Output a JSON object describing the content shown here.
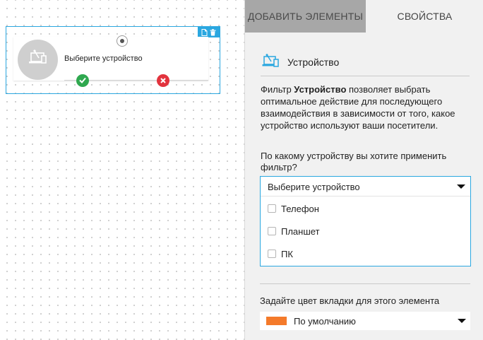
{
  "canvas": {
    "node": {
      "label": "Выберите устройство",
      "avatar_icon": "device-icon",
      "tool_icons": [
        "copy-icon",
        "trash-icon"
      ],
      "ports": {
        "yes_color": "#2fa84f",
        "no_color": "#e2333d"
      }
    }
  },
  "tabs": [
    {
      "label": "ДОБАВИТЬ ЭЛЕМЕНТЫ",
      "active": false
    },
    {
      "label": "СВОЙСТВА",
      "active": true
    }
  ],
  "properties": {
    "section_title": "Устройство",
    "section_icon": "device-icon",
    "description": {
      "before": "Фильтр ",
      "bold": "Устройство",
      "after": " позволяет выбрать оптимальное действие для последующего взаимодействия в зависимости от того, какое устройство используют ваши посетители."
    },
    "question": "По какому устройству вы хотите применить фильтр?",
    "device_select": {
      "value": "Выберите устройство",
      "options": [
        "Телефон",
        "Планшет",
        "ПК"
      ]
    },
    "color_label": "Задайте цвет вкладки для этого элемента",
    "color_select": {
      "value": "По умолчанию",
      "swatch_color": "#f47a2a"
    }
  },
  "colors": {
    "accent": "#2aa7e0",
    "tab_inactive_bg": "#a7a7a7",
    "panel_bg": "#f1f1f1"
  }
}
